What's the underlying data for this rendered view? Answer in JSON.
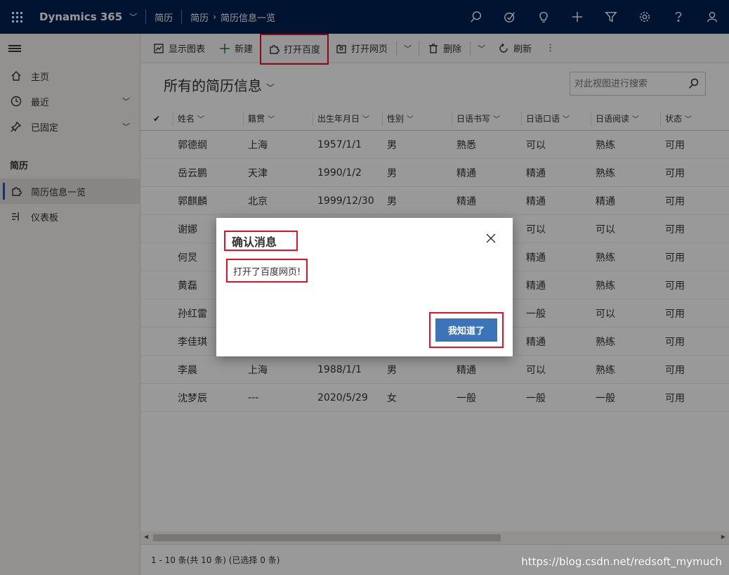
{
  "topbar": {
    "app_title": "Dynamics 365",
    "app_area": "简历",
    "breadcrumb": [
      "简历",
      "简历信息一览"
    ],
    "icons": [
      "search-icon",
      "task-icon",
      "lightbulb-icon",
      "plus-icon",
      "filter-icon",
      "gear-icon",
      "help-icon",
      "user-icon"
    ]
  },
  "sidebar": {
    "items": [
      {
        "label": "主页",
        "icon": "home-icon"
      },
      {
        "label": "最近",
        "icon": "clock-icon",
        "expandable": true
      },
      {
        "label": "已固定",
        "icon": "pin-icon",
        "expandable": true
      }
    ],
    "section_title": "简历",
    "section_items": [
      {
        "label": "简历信息一览",
        "icon": "puzzle-icon",
        "selected": true
      },
      {
        "label": "仪表板",
        "icon": "dashboard-icon"
      }
    ]
  },
  "commandbar": {
    "show_chart": "显示图表",
    "new": "新建",
    "open_baidu": "打开百度",
    "open_web": "打开网页",
    "delete": "删除",
    "refresh": "刷新",
    "more": "⋮"
  },
  "view": {
    "title": "所有的简历信息",
    "search_placeholder": "对此视图进行搜索"
  },
  "grid": {
    "columns": [
      "姓名",
      "籍贯",
      "出生年月日",
      "性别",
      "日语书写",
      "日语口语",
      "日语阅读",
      "状态"
    ],
    "rows": [
      [
        "郭德纲",
        "上海",
        "1957/1/1",
        "男",
        "熟悉",
        "可以",
        "熟练",
        "可用"
      ],
      [
        "岳云鹏",
        "天津",
        "1990/1/2",
        "男",
        "精通",
        "精通",
        "熟练",
        "可用"
      ],
      [
        "郭麒麟",
        "北京",
        "1999/12/30",
        "男",
        "精通",
        "精通",
        "精通",
        "可用"
      ],
      [
        "谢娜",
        "",
        "",
        "",
        "",
        "可以",
        "可以",
        "可用"
      ],
      [
        "何炅",
        "",
        "",
        "",
        "",
        "精通",
        "熟练",
        "可用"
      ],
      [
        "黄磊",
        "",
        "",
        "",
        "",
        "精通",
        "熟练",
        "可用"
      ],
      [
        "孙红雷",
        "",
        "",
        "",
        "",
        "一般",
        "可以",
        "可用"
      ],
      [
        "李佳琪",
        "",
        "",
        "",
        "",
        "精通",
        "熟练",
        "可用"
      ],
      [
        "李晨",
        "上海",
        "1988/1/1",
        "男",
        "精通",
        "可以",
        "熟练",
        "可用"
      ],
      [
        "沈梦辰",
        "---",
        "2020/5/29",
        "女",
        "一般",
        "一般",
        "一般",
        "可用"
      ]
    ]
  },
  "footer": {
    "status": "1 - 10 条(共 10 条) (已选择 0 条)"
  },
  "watermark": "https://blog.csdn.net/redsoft_mymuch",
  "dialog": {
    "title": "确认消息",
    "message": "打开了百度网页!",
    "ok": "我知道了"
  },
  "colors": {
    "topbar": "#002050",
    "accent": "#3b74b9",
    "highlight": "#e81123"
  }
}
